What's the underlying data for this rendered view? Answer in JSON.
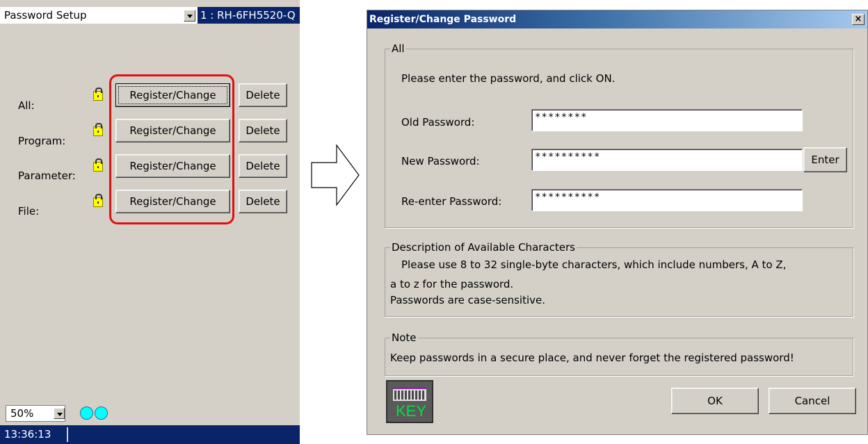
{
  "left": {
    "title": "Password Setup",
    "robot": "1 : RH-6FH5520-Q",
    "rows": [
      {
        "label": "All:",
        "register": "Register/Change",
        "delete": "Delete"
      },
      {
        "label": "Program:",
        "register": "Register/Change",
        "delete": "Delete"
      },
      {
        "label": "Parameter:",
        "register": "Register/Change",
        "delete": "Delete"
      },
      {
        "label": "File:",
        "register": "Register/Change",
        "delete": "Delete"
      }
    ],
    "zoom": "50%",
    "time": "13:36:13",
    "led_color": "#00ffff",
    "highlight_color": "#e01010"
  },
  "dialog": {
    "title": "Register/Change Password",
    "close": "×",
    "all_group": {
      "legend": "All",
      "instruction": "Please enter the password, and click ON.",
      "old_label": "Old Password:",
      "old_value": "********",
      "new_label": "New Password:",
      "new_value": "**********",
      "reenter_label": "Re-enter Password:",
      "reenter_value": "**********",
      "enter_button": "Enter"
    },
    "desc_group": {
      "legend": "Description of Available Characters",
      "line1": "Please use 8 to 32 single-byte characters, which include numbers, A to Z,",
      "line2": "a to z for the password.",
      "line3": "Passwords are case-sensitive."
    },
    "note_group": {
      "legend": "Note",
      "text": "Keep passwords in a secure place, and never forget the registered password!"
    },
    "key_icon_text": "KEY",
    "ok": "OK",
    "cancel": "Cancel"
  }
}
